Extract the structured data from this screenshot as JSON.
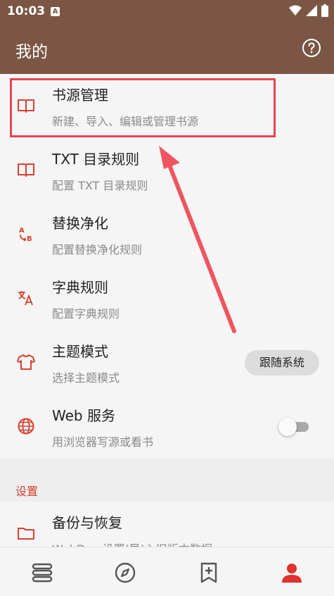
{
  "status_bar": {
    "time": "10:03",
    "badge": "A"
  },
  "app_bar": {
    "title": "我的"
  },
  "items": [
    {
      "title": "书源管理",
      "subtitle": "新建、导入、编辑或管理书源",
      "icon": "book-open-icon"
    },
    {
      "title": "TXT 目录规则",
      "subtitle": "配置 TXT 目录规则",
      "icon": "book-open-icon"
    },
    {
      "title": "替换净化",
      "subtitle": "配置替换净化规则",
      "icon": "replace-ab-icon"
    },
    {
      "title": "字典规则",
      "subtitle": "配置字典规则",
      "icon": "translate-icon"
    },
    {
      "title": "主题模式",
      "subtitle": "选择主题模式",
      "icon": "shirt-icon"
    },
    {
      "title": "Web 服务",
      "subtitle": "用浏览器写源或看书",
      "icon": "globe-icon"
    }
  ],
  "theme_mode_value": "跟随系统",
  "web_service_enabled": false,
  "settings_section": {
    "label": "设置",
    "items": [
      {
        "title": "备份与恢复",
        "subtitle": "WebDav 设置(导)入旧版本数据",
        "icon": "folder-icon"
      }
    ]
  },
  "bottom_nav": [
    "bookshelf-icon",
    "compass-icon",
    "bookmark-add-icon",
    "person-icon"
  ],
  "colors": {
    "primary": "#7b5645",
    "accent": "#d8402f",
    "highlight": "#e8454f"
  }
}
